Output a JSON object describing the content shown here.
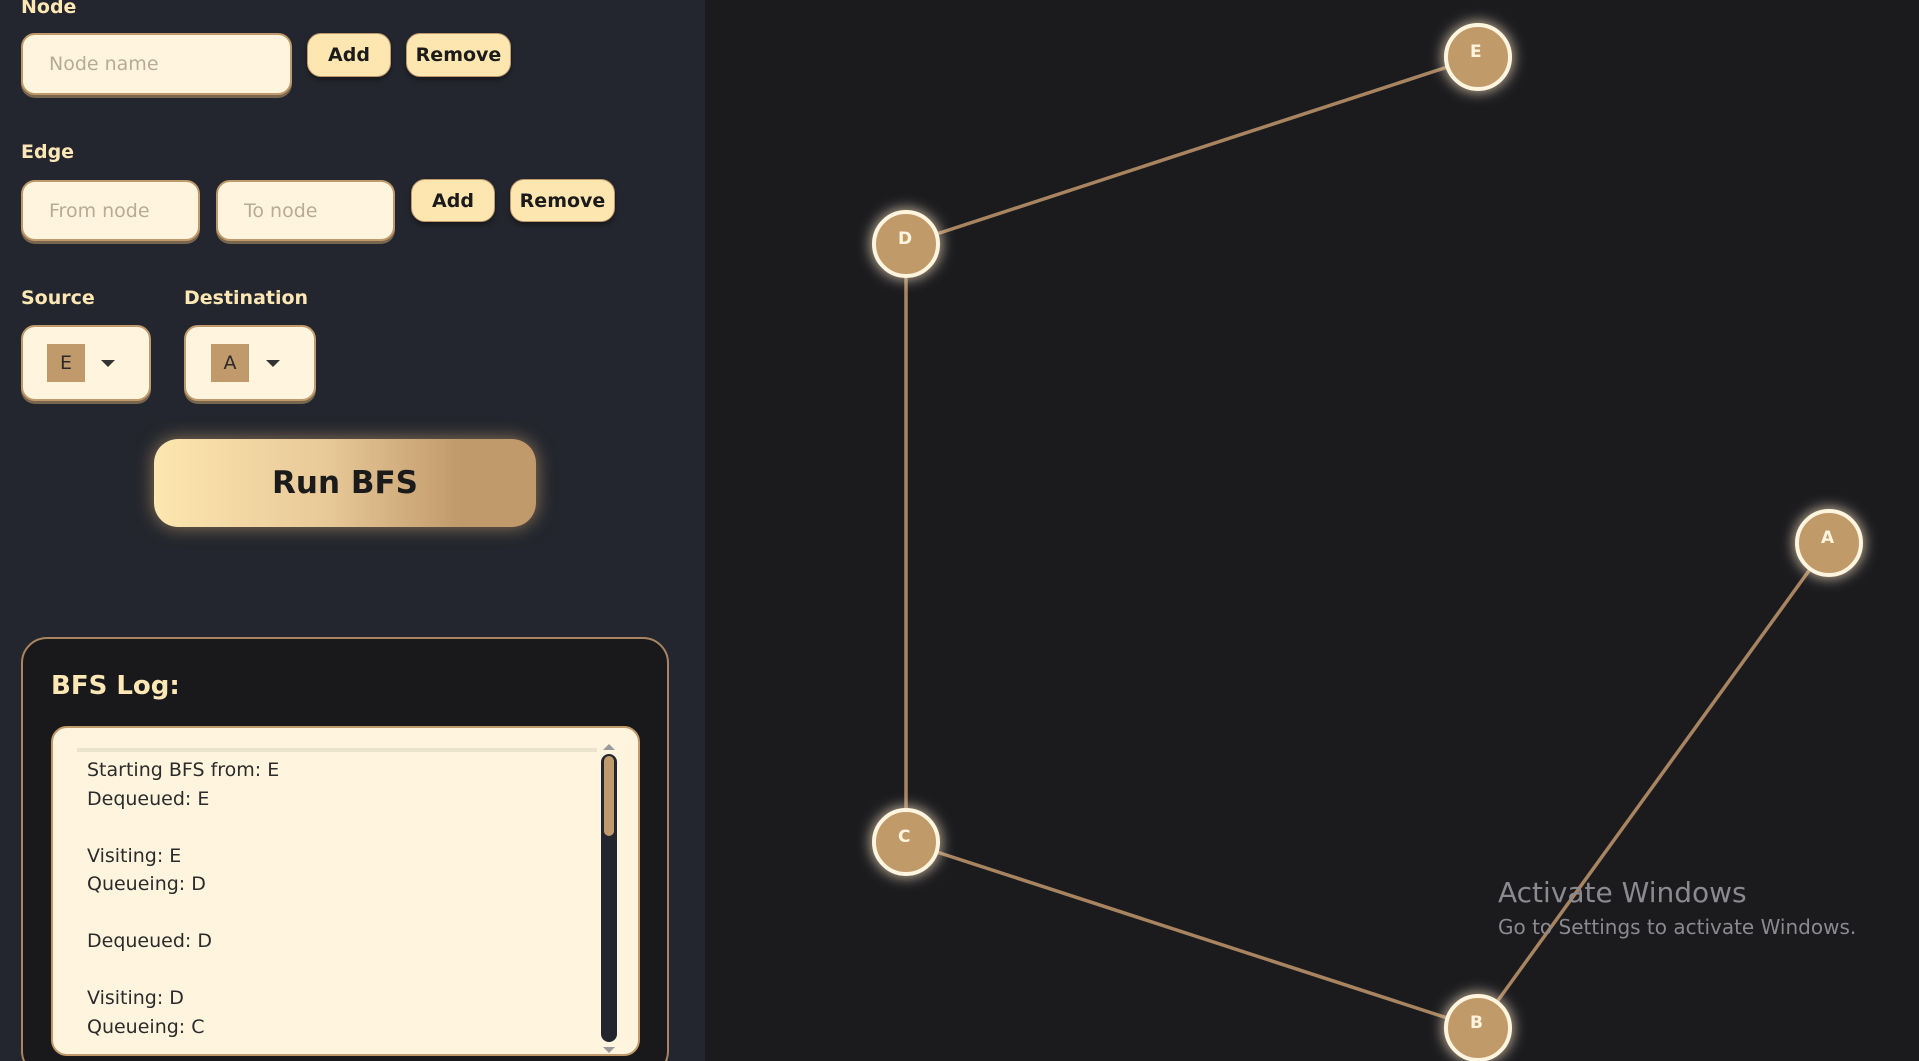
{
  "node_section": {
    "label": "Node",
    "input_placeholder": "Node name",
    "add_label": "Add",
    "remove_label": "Remove"
  },
  "edge_section": {
    "label": "Edge",
    "from_placeholder": "From node",
    "to_placeholder": "To node",
    "add_label": "Add",
    "remove_label": "Remove"
  },
  "source": {
    "label": "Source",
    "selected": "E"
  },
  "destination": {
    "label": "Destination",
    "selected": "A"
  },
  "run_button": "Run BFS",
  "log": {
    "title": "BFS Log:",
    "lines": [
      "Starting BFS from: E",
      "Dequeued: E",
      "",
      "Visiting: E",
      "Queueing: D",
      "",
      "Dequeued: D",
      "",
      "Visiting: D",
      "Queueing: C"
    ]
  },
  "graph": {
    "nodes": [
      "E",
      "D",
      "A",
      "C",
      "B"
    ],
    "edges": [
      [
        "E",
        "D"
      ],
      [
        "D",
        "C"
      ],
      [
        "C",
        "B"
      ],
      [
        "B",
        "A"
      ]
    ]
  },
  "watermark": {
    "title": "Activate Windows",
    "subtitle": "Go to Settings to activate Windows."
  },
  "colors": {
    "accent": "#c19a6b",
    "light": "#fde6b0",
    "panel": "#23262e",
    "canvas": "#1b1b1e"
  }
}
